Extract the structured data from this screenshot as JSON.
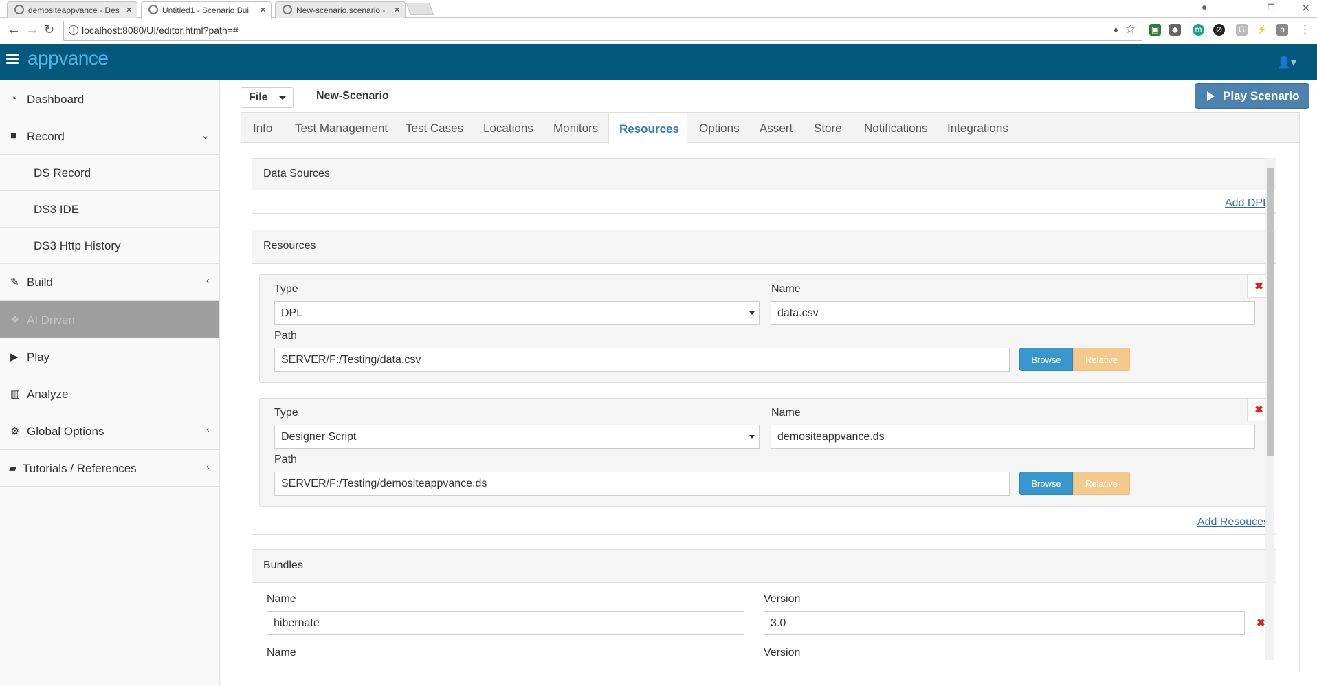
{
  "browser": {
    "tabs": [
      {
        "title": "demositeappvance - Des"
      },
      {
        "title": "Untitled1 - Scenario Buil"
      },
      {
        "title": "New-scenario.scenario -"
      }
    ],
    "url": "localhost:8080/UI/editor.html?path=#"
  },
  "app": {
    "logo": "appvance"
  },
  "sidebar": {
    "items": [
      {
        "label": "Dashboard",
        "icon": "dashboard-icon"
      },
      {
        "label": "Record",
        "icon": "video-camera-icon"
      },
      {
        "label": "DS Record"
      },
      {
        "label": "DS3 IDE"
      },
      {
        "label": "DS3 Http History"
      },
      {
        "label": "Build",
        "icon": "wrench-icon"
      },
      {
        "label": "AI Driven",
        "icon": "cubes-icon"
      },
      {
        "label": "Play",
        "icon": "play-icon"
      },
      {
        "label": "Analyze",
        "icon": "bar-chart-icon"
      },
      {
        "label": "Global Options",
        "icon": "cogs-icon"
      },
      {
        "label": "Tutorials / References",
        "icon": "book-icon"
      }
    ]
  },
  "toolbar": {
    "file_label": "File",
    "scenario_name": "New-Scenario",
    "play_label": "Play Scenario"
  },
  "tabs": [
    "Info",
    "Test Management",
    "Test Cases",
    "Locations",
    "Monitors",
    "Resources",
    "Options",
    "Assert",
    "Store",
    "Notifications",
    "Integrations"
  ],
  "active_tab": "Resources",
  "data_sources": {
    "title": "Data Sources",
    "add_link": "Add DPL"
  },
  "resources": {
    "title": "Resources",
    "type_label": "Type",
    "name_label": "Name",
    "path_label": "Path",
    "browse_label": "Browse",
    "relative_label": "Relative",
    "items": [
      {
        "type": "DPL",
        "name": "data.csv",
        "path": "SERVER/F:/Testing/data.csv"
      },
      {
        "type": "Designer Script",
        "name": "demositeappvance.ds",
        "path": "SERVER/F:/Testing/demositeappvance.ds"
      }
    ],
    "add_link": "Add Resouces"
  },
  "bundles": {
    "title": "Bundles",
    "name_label": "Name",
    "version_label": "Version",
    "items": [
      {
        "name": "hibernate",
        "version": "3.0"
      }
    ]
  },
  "colors": {
    "header": "#04587b",
    "play_button": "#4c82ad",
    "browse": "#3997cf",
    "relative": "#f3c98e",
    "delete": "#d9231f",
    "active_tab": "#337ab7"
  }
}
